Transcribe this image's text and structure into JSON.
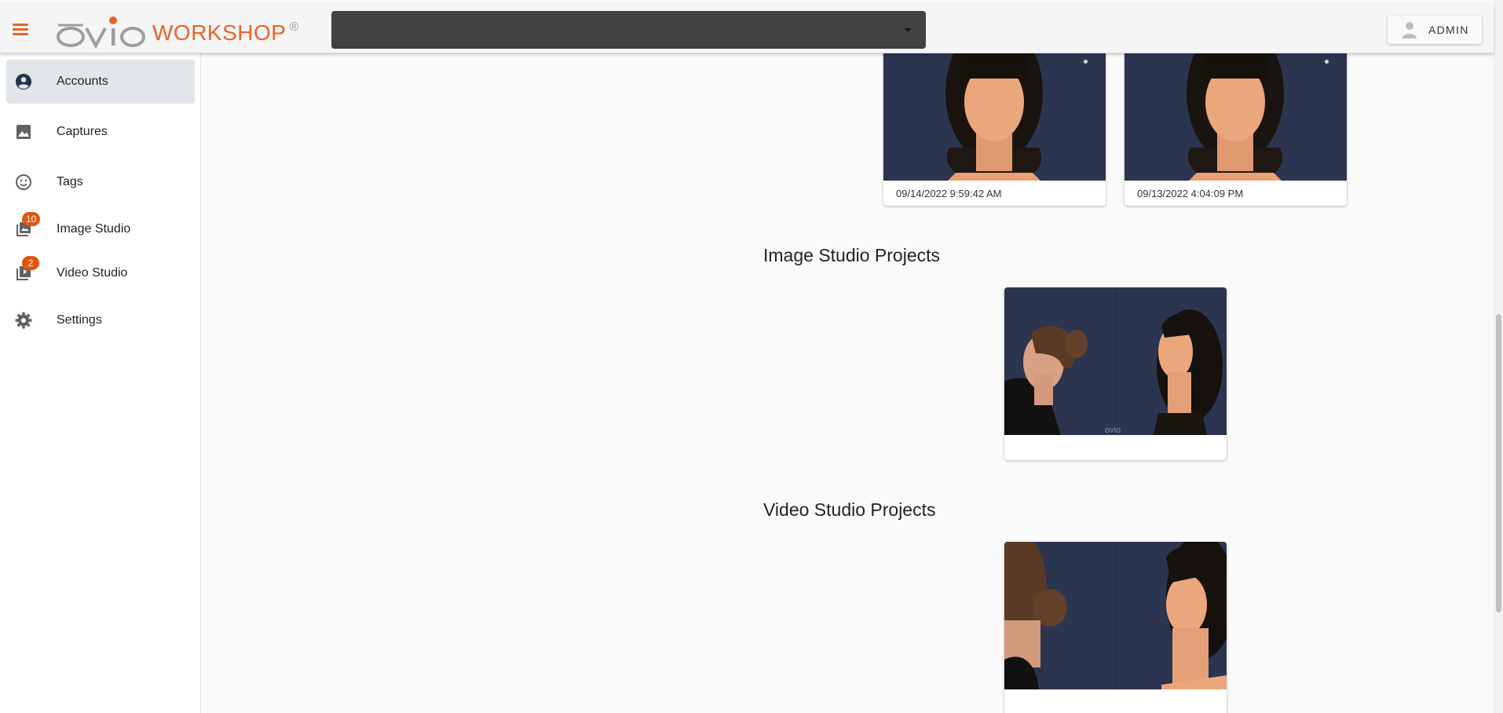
{
  "header": {
    "logo_text": "WORKSHOP",
    "logo_reg": "®",
    "account_select_value": "",
    "user_label": "ADMIN"
  },
  "sidebar": {
    "items": [
      {
        "label": "Accounts",
        "icon": "account-circle-icon",
        "active": true
      },
      {
        "label": "Captures",
        "icon": "image-icon"
      },
      {
        "label": "Tags",
        "icon": "smiley-face-icon"
      },
      {
        "label": "Image Studio",
        "icon": "photo-library-icon",
        "badge": "10"
      },
      {
        "label": "Video Studio",
        "icon": "video-library-icon",
        "badge": "2"
      },
      {
        "label": "Settings",
        "icon": "gear-icon"
      }
    ]
  },
  "captures": [
    {
      "date": "09/14/2022 9:59:42 AM"
    },
    {
      "date": "09/13/2022 4:04:09 PM"
    }
  ],
  "sections": {
    "image_studio_title": "Image Studio Projects",
    "video_studio_title": "Video Studio Projects"
  },
  "colors": {
    "brand": "#e8632a",
    "badge": "#e2550f",
    "photo_background": "#2b3550"
  }
}
